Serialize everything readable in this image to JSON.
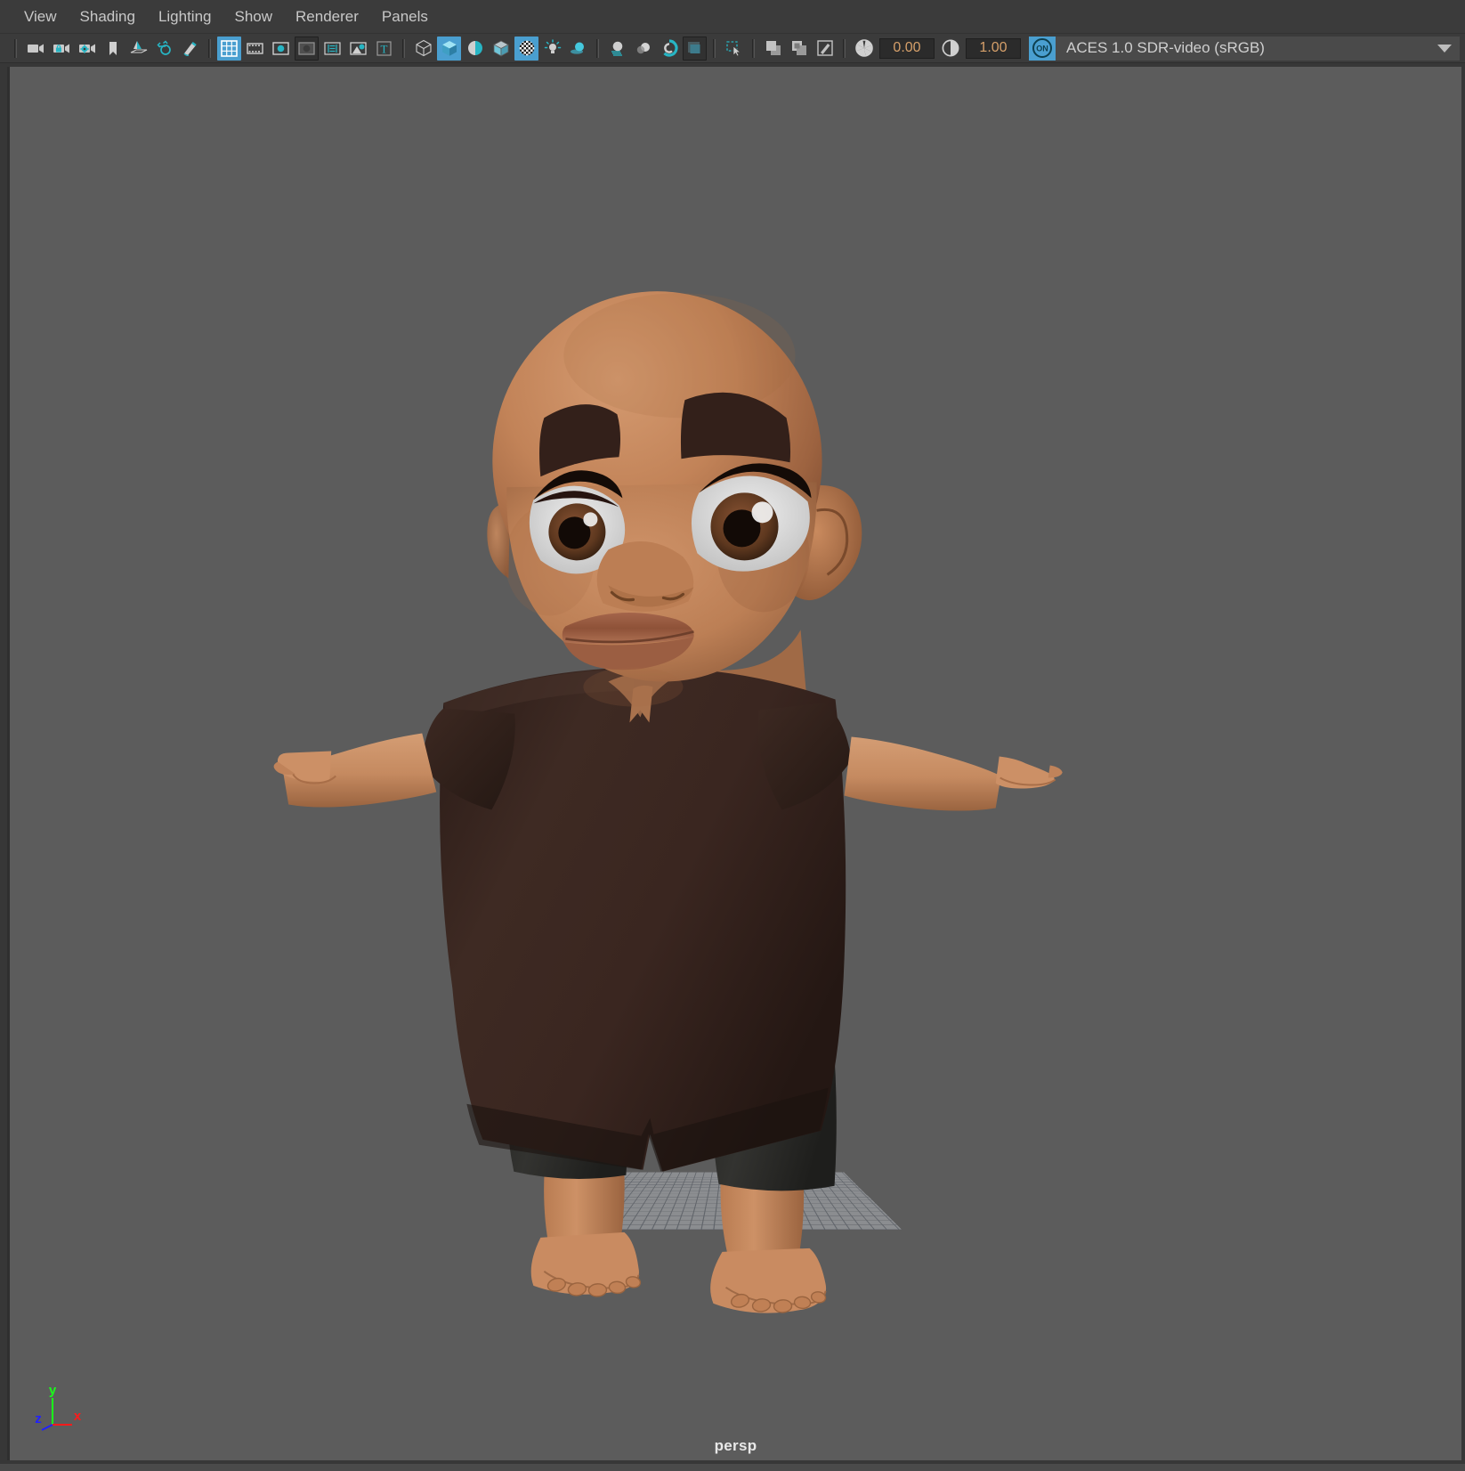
{
  "window": {
    "app": "Autodesk Maya",
    "panel_type": "modelPanel"
  },
  "menubar": {
    "items": [
      {
        "label": "View",
        "name": "menu-view"
      },
      {
        "label": "Shading",
        "name": "menu-shading"
      },
      {
        "label": "Lighting",
        "name": "menu-lighting"
      },
      {
        "label": "Show",
        "name": "menu-show"
      },
      {
        "label": "Renderer",
        "name": "menu-renderer"
      },
      {
        "label": "Panels",
        "name": "menu-panels"
      }
    ]
  },
  "toolbar": {
    "groups": [
      {
        "buttons": [
          {
            "icon": "camera-icon",
            "state": "off"
          },
          {
            "icon": "lock-camera-icon",
            "state": "off"
          },
          {
            "icon": "camera-attributes-icon",
            "state": "off"
          },
          {
            "icon": "bookmark-icon",
            "state": "off"
          },
          {
            "icon": "grid-plane-icon",
            "state": "off"
          },
          {
            "icon": "zoom-region-icon",
            "state": "off"
          },
          {
            "icon": "paint-effects-icon",
            "state": "off"
          }
        ]
      },
      {
        "buttons": [
          {
            "icon": "grid-toggle-icon",
            "state": "on"
          },
          {
            "icon": "film-gate-icon",
            "state": "off"
          },
          {
            "icon": "resolution-gate-icon",
            "state": "off"
          },
          {
            "icon": "gate-mask-icon",
            "state": "pressed"
          },
          {
            "icon": "field-chart-icon",
            "state": "off"
          },
          {
            "icon": "image-plane-icon",
            "state": "off"
          },
          {
            "icon": "hud-text-icon",
            "state": "off"
          }
        ]
      },
      {
        "buttons": [
          {
            "icon": "wireframe-shading-icon",
            "state": "off"
          },
          {
            "icon": "smooth-shade-all-icon",
            "state": "on"
          },
          {
            "icon": "shade-selected-items-icon",
            "state": "off"
          },
          {
            "icon": "wireframe-on-shaded-icon",
            "state": "off"
          },
          {
            "icon": "texture-shading-icon",
            "state": "on"
          },
          {
            "icon": "use-default-lighting-icon",
            "state": "off"
          },
          {
            "icon": "shadows-icon",
            "state": "off"
          }
        ]
      },
      {
        "buttons": [
          {
            "icon": "screen-space-ao-icon",
            "state": "off"
          },
          {
            "icon": "motion-blur-icon",
            "state": "off"
          },
          {
            "icon": "multisample-aa-icon",
            "state": "off"
          },
          {
            "icon": "depth-of-field-icon",
            "state": "pressed"
          }
        ]
      },
      {
        "buttons": [
          {
            "icon": "isolate-select-icon",
            "state": "off"
          }
        ]
      },
      {
        "buttons": [
          {
            "icon": "xray-mode-icon",
            "state": "off"
          },
          {
            "icon": "xray-joints-icon",
            "state": "off"
          },
          {
            "icon": "xray-active-components-icon",
            "state": "off"
          }
        ]
      }
    ],
    "exposure": {
      "icon": "exposure-icon",
      "value": "0.00",
      "name": "exposure-field"
    },
    "gamma": {
      "icon": "gamma-icon",
      "value": "1.00",
      "name": "gamma-field"
    },
    "color_management": {
      "toggle_label": "ON",
      "toggle_state": "on",
      "view_transform": "ACES 1.0 SDR-video (sRGB)"
    }
  },
  "viewport": {
    "camera_label": "persp",
    "background_color": "#5c5c5c",
    "axis_gizmo": {
      "x_label": "x",
      "y_label": "y",
      "z_label": "z",
      "x_color": "#ff1a1a",
      "y_color": "#1aff1a",
      "z_color": "#2020ff"
    },
    "grid": {
      "visible": true,
      "color": "#8d8f92"
    },
    "subject": {
      "description": "3D cartoon toddler character in T-pose",
      "skin_color": "#c98c63",
      "skin_shadow_color": "#8d5a3c",
      "shirt_color": "#3a2620",
      "shirt_shadow_color": "#2a1a16",
      "shorts_color": "#2e2e2b",
      "shorts_shadow_color": "#1d1d1b",
      "eyebrow_color": "#2e1a12",
      "eye_white_color": "#dcdcdc",
      "iris_color": "#6d4028",
      "pupil_color": "#120a06",
      "lip_color": "#a4654b"
    }
  }
}
